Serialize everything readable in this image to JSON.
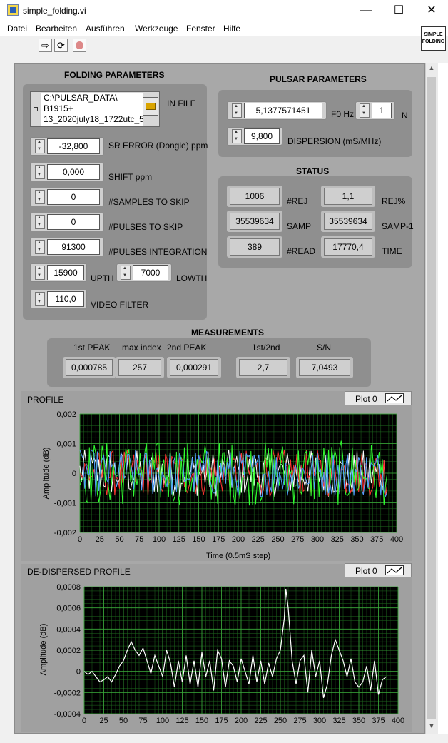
{
  "window": {
    "title": "simple_folding.vi",
    "minimize": "—",
    "maximize": "☐",
    "close": "✕"
  },
  "menu": [
    "Datei",
    "Bearbeiten",
    "Ausführen",
    "Werkzeuge",
    "Fenster",
    "Hilfe"
  ],
  "toolbar": {
    "run_icon": "run-arrow-icon",
    "continuous_icon": "continuous-run-icon",
    "stop_icon": "abort-icon",
    "vi_icon_text": [
      "SIMPLE",
      "FOLDING"
    ]
  },
  "folding": {
    "title": "FOLDING PARAMETERS",
    "in_file_label": "IN FILE",
    "in_file_lines": [
      "C:\\PULSAR_DATA\\",
      "B1915+",
      "13_2020july18_1722utc_5"
    ],
    "sr_error": {
      "value": "-32,800",
      "label": "SR ERROR (Dongle) ppm"
    },
    "shift": {
      "value": "0,000",
      "label": "SHIFT ppm"
    },
    "samples_skip": {
      "value": "0",
      "label": "#SAMPLES TO SKIP"
    },
    "pulses_skip": {
      "value": "0",
      "label": "#PULSES TO SKIP"
    },
    "pulses_integration": {
      "value": "91300",
      "label": "#PULSES INTEGRATION"
    },
    "upth": {
      "value": "15900",
      "label": "UPTH"
    },
    "lowth": {
      "value": "7000",
      "label": "LOWTH"
    },
    "video_filter": {
      "value": "110,0",
      "label": "VIDEO FILTER"
    }
  },
  "pulsar": {
    "title": "PULSAR PARAMETERS",
    "f0": {
      "value": "5,1377571451",
      "label": "F0 Hz"
    },
    "n": {
      "value": "1",
      "label": "N"
    },
    "dispersion": {
      "value": "9,800",
      "label": "DISPERSION (mS/MHz)"
    }
  },
  "status": {
    "title": "STATUS",
    "rej": {
      "value": "1006",
      "label": "#REJ"
    },
    "rej_pct": {
      "value": "1,1",
      "label": "REJ%"
    },
    "samp": {
      "value": "35539634",
      "label": "SAMP"
    },
    "samp1": {
      "value": "35539634",
      "label": "SAMP-1"
    },
    "read": {
      "value": "389",
      "label": "#READ"
    },
    "time": {
      "value": "17770,4",
      "label": "TIME"
    }
  },
  "measurements": {
    "title": "MEASUREMENTS",
    "first_peak": {
      "label": "1st PEAK",
      "value": "0,000785"
    },
    "max_index": {
      "label": "max index",
      "value": "257"
    },
    "second_peak": {
      "label": "2nd PEAK",
      "value": "0,000291"
    },
    "ratio": {
      "label": "1st/2nd",
      "value": "2,7"
    },
    "sn": {
      "label": "S/N",
      "value": "7,0493"
    }
  },
  "profile": {
    "title": "PROFILE",
    "legend": "Plot 0",
    "ylabel": "Amplitude (dB)",
    "xlabel": "Time (0.5mS step)",
    "yticks": [
      "0,002",
      "0,001",
      "0",
      "-0,001",
      "-0,002"
    ],
    "xticks": [
      "0",
      "25",
      "50",
      "75",
      "100",
      "125",
      "150",
      "175",
      "200",
      "225",
      "250",
      "275",
      "300",
      "325",
      "350",
      "375",
      "400"
    ],
    "colors": [
      "#ffffff",
      "#ff3030",
      "#30ff30",
      "#4fa0ff"
    ]
  },
  "dedispersed": {
    "title": "DE-DISPERSED PROFILE",
    "legend": "Plot 0",
    "ylabel": "Amplitude (dB)",
    "yticks": [
      "0,0008",
      "0,0006",
      "0,0004",
      "0,0002",
      "0",
      "-0,0002",
      "-0,0004"
    ],
    "xticks": [
      "0",
      "25",
      "50",
      "75",
      "100",
      "125",
      "150",
      "175",
      "200",
      "225",
      "250",
      "275",
      "300",
      "325",
      "350",
      "375",
      "400"
    ]
  },
  "chart_data": [
    {
      "type": "line",
      "title": "PROFILE",
      "xlabel": "Time (0.5mS step)",
      "ylabel": "Amplitude (dB)",
      "xlim": [
        0,
        400
      ],
      "ylim": [
        -0.002,
        0.002
      ],
      "grid": true,
      "series": [
        {
          "name": "Plot 0",
          "values": []
        }
      ]
    },
    {
      "type": "line",
      "title": "DE-DISPERSED PROFILE",
      "xlabel": "",
      "ylabel": "Amplitude (dB)",
      "xlim": [
        0,
        400
      ],
      "ylim": [
        -0.0004,
        0.0008
      ],
      "grid": true,
      "series": [
        {
          "name": "Plot 0",
          "x": [
            0,
            5,
            10,
            15,
            20,
            25,
            30,
            35,
            40,
            45,
            50,
            55,
            60,
            65,
            70,
            75,
            80,
            85,
            90,
            95,
            100,
            105,
            110,
            115,
            120,
            125,
            130,
            135,
            140,
            145,
            150,
            155,
            160,
            165,
            170,
            175,
            180,
            185,
            190,
            195,
            200,
            205,
            210,
            215,
            220,
            225,
            230,
            235,
            240,
            245,
            250,
            255,
            257,
            260,
            265,
            270,
            275,
            280,
            285,
            290,
            295,
            300,
            305,
            310,
            315,
            320,
            325,
            330,
            335,
            340,
            345,
            350,
            355,
            360,
            365,
            370,
            375,
            380,
            385
          ],
          "values": [
            0,
            -3e-05,
            0,
            -5e-05,
            -0.0001,
            -8e-05,
            -5e-05,
            -0.0001,
            -3e-05,
            5e-05,
            0.0001,
            0.0002,
            0.00028,
            0.0002,
            0.00015,
            0.00022,
            0.0001,
            -2e-05,
            0.00015,
            5e-05,
            -5e-05,
            0.0002,
            8e-05,
            -0.00015,
            0.0001,
            -0.0001,
            0.00015,
            -0.00012,
            0.0001,
            -0.00015,
            0.00018,
            -5e-05,
            0.0001,
            -0.00018,
            0.0002,
            0.00012,
            -0.00015,
            0.0001,
            5e-05,
            -0.0001,
            0.00012,
            0,
            -0.00012,
            0.00015,
            -0.0001,
            0.0001,
            -0.00012,
            8e-05,
            -5e-05,
            0.00012,
            0.0002,
            0.0005,
            0.00078,
            0.0006,
            0.0001,
            -0.00012,
            0.0001,
            0.00015,
            -0.0002,
            0.0002,
            -5e-05,
            0.0001,
            -0.00025,
            -0.00012,
            0.00015,
            0.0003,
            0.0002,
            0.0001,
            -5e-05,
            0.00012,
            -0.0001,
            -0.00015,
            -0.0001,
            5e-05,
            -0.00018,
            0.0001,
            -0.00022,
            -8e-05,
            -5e-05
          ]
        }
      ]
    }
  ]
}
